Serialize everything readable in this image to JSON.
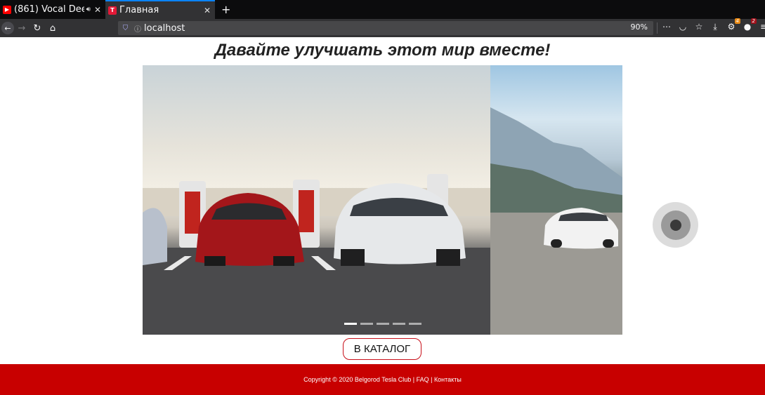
{
  "browser": {
    "tabs": [
      {
        "title": "(861) Vocal Dee",
        "favicon": "youtube-icon",
        "active": false
      },
      {
        "title": "Главная",
        "favicon": "tesla-icon",
        "active": true
      }
    ],
    "new_tab_label": "+",
    "url": "localhost",
    "zoom": "90%",
    "extension_badges": {
      "first": "4",
      "second": "2"
    }
  },
  "page": {
    "heading": "Давайте улучшать этот мир вместе!",
    "slider": {
      "slide_count": 5,
      "active_index": 0,
      "next_button_icon": "circle-target-icon"
    },
    "catalog_button": "В КАТАЛОГ",
    "footer": {
      "copyright": "Copyright © 2020 Belgorod Tesla Club",
      "sep1": " | ",
      "faq": "FAQ",
      "sep2": " | ",
      "contacts": "Контакты"
    }
  },
  "colors": {
    "brand_red": "#c80000",
    "accent_blue": "#0a84ff"
  }
}
